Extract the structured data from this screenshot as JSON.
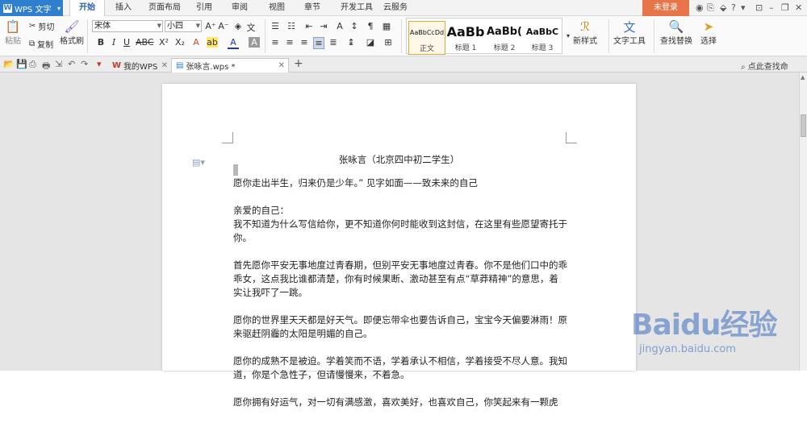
{
  "app": {
    "name": "WPS 文字"
  },
  "menu": {
    "tabs": [
      "开始",
      "插入",
      "页面布局",
      "引用",
      "审阅",
      "视图",
      "章节",
      "开发工具",
      "云服务"
    ],
    "login": "未登录"
  },
  "ribbon": {
    "paste": "粘贴",
    "cut": "剪切",
    "copy": "复制",
    "format_painter": "格式刷",
    "font_name": "宋体",
    "font_size": "小四",
    "styles": [
      {
        "sample": "AaBbCcDd",
        "label": "正文"
      },
      {
        "sample": "AaBb",
        "label": "标题 1"
      },
      {
        "sample": "AaBb(",
        "label": "标题 2"
      },
      {
        "sample": "AaBbC",
        "label": "标题 3"
      }
    ],
    "new_style": "新样式",
    "text_tools": "文字工具",
    "find_replace": "查找替换",
    "select": "选择"
  },
  "tabs": {
    "doc1": "我的WPS",
    "doc2": "张咏言.wps *",
    "search_hint": "点此查找命"
  },
  "document": {
    "title": "张咏言（北京四中初二学生）",
    "paragraphs": [
      "愿你走出半生，归来仍是少年。” 见字如面——致未来的自己",
      "亲爱的自己：\n我不知道为什么写信给你，更不知道你何时能收到这封信，在这里有些愿望寄托于你。",
      "首先愿你平安无事地度过青春期，但别平安无事地度过青春。你不是他们口中的乖乖女，这点我比谁都清楚，你有时候果断、激动甚至有点“草莽精神”的意思，着实让我吓了一跳。",
      "愿你的世界里天天都是好天气。即便忘带伞也要告诉自己，宝宝今天偏要淋雨！原来驱赶阴霾的太阳是明媚的自己。",
      "愿你的成熟不是被迫。学着笑而不语，学着承认不相信，学着接受不尽人意。我知道，你是个急性子，但请慢慢来，不着急。",
      "愿你拥有好运气，对一切有满感激，喜欢美好，也喜欢自己，你笑起来有一颗虎"
    ]
  },
  "watermark": {
    "brand": "Baidu经验",
    "url": "jingyan.baidu.com"
  },
  "colors": {
    "accent": "#2f7fd1",
    "login": "#e8744a",
    "canvas": "#e5e5e5"
  }
}
